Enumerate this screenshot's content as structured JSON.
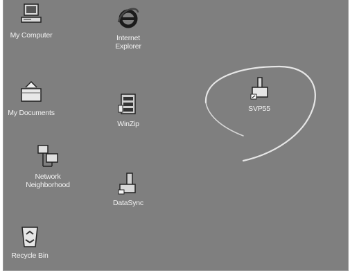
{
  "desktop": {
    "icons": [
      {
        "label": "My Computer",
        "icon": "my-computer-icon"
      },
      {
        "label": "Internet\nExplorer",
        "icon": "internet-explorer-icon"
      },
      {
        "label": "My Documents",
        "icon": "my-documents-icon"
      },
      {
        "label": "WinZip",
        "icon": "winzip-icon"
      },
      {
        "label": "Network\nNeighborhood",
        "icon": "network-neighborhood-icon"
      },
      {
        "label": "DataSync",
        "icon": "datasync-icon"
      },
      {
        "label": "Recycle Bin",
        "icon": "recycle-bin-icon"
      },
      {
        "label": "SVP55",
        "icon": "svp55-shortcut-icon"
      }
    ]
  },
  "colors": {
    "desktop_background": "#7f7f7f",
    "label_text": "#f2f2f2",
    "annotation_stroke": "#e6e6e6"
  }
}
